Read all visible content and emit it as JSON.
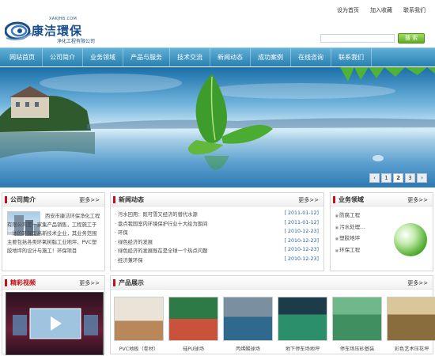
{
  "toplinks": [
    "设为首页",
    "加入收藏",
    "联系我们"
  ],
  "logo": {
    "domain": "XAKJHB.COM",
    "name": "康洁環保",
    "sub": "净化工程有限公司"
  },
  "search": {
    "button": "搜 索"
  },
  "nav": [
    "网站首页",
    "公司简介",
    "业务领域",
    "产品与服务",
    "技术交流",
    "新闻动态",
    "成功案例",
    "在线咨询",
    "联系我们"
  ],
  "banner": {
    "pager": [
      "‹",
      "1",
      "2",
      "3",
      "›"
    ]
  },
  "intro": {
    "title": "公司简介",
    "more": "更多>>",
    "text": "西安市康洁环保净化工程有限公司是一家集产品销售，工程施工于一体的环保型高新技术企业，其业务范围主要包括各类环氧树脂工业地坪、PVC塑胶地坪的设计与施工！环保项目"
  },
  "news": {
    "title": "新闻动态",
    "more": "更多>>",
    "items": [
      {
        "t": "污水回用：既可雪又经济的替代水源",
        "d": "[ 2011-01-12]"
      },
      {
        "t": "盘点我国室内环境保护行业十大绘为期间",
        "d": "[ 2011-01-12]"
      },
      {
        "t": "环保",
        "d": "[ 2010-12-23]"
      },
      {
        "t": "绿色经济的发展",
        "d": "[ 2010-12-23]"
      },
      {
        "t": "绿色经济的发展既在是全球一个热点问题",
        "d": "[ 2010-12-23]"
      },
      {
        "t": "经济兼环保",
        "d": "[ 2010-12-23]"
      }
    ]
  },
  "biz": {
    "title": "业务领域",
    "more": "更多>>",
    "items": [
      "防腐工程",
      "污水处理...",
      "塑胶地坪",
      "环保工程"
    ]
  },
  "video": {
    "title": "精彩视频",
    "more": "更多>>"
  },
  "products": {
    "title": "产品展示",
    "more": "更多>>",
    "items": [
      {
        "cap": "PVC地板（卷材）",
        "colors": [
          "#e9e3d8",
          "#b8875a"
        ]
      },
      {
        "cap": "硅PU球场",
        "colors": [
          "#2d7a47",
          "#c9523a"
        ]
      },
      {
        "cap": "丙烯酸球场",
        "colors": [
          "#7a8fa0",
          "#2f6a8e"
        ]
      },
      {
        "cap": "地下停车场地坪",
        "colors": [
          "#1d3c4a",
          "#2a8f6a"
        ]
      },
      {
        "cap": "停车场压砂基装",
        "colors": [
          "#6fb889",
          "#3f8f60"
        ]
      },
      {
        "cap": "彩色艺术压花坪",
        "colors": [
          "#d9c79a",
          "#8a6d3c"
        ]
      }
    ]
  }
}
